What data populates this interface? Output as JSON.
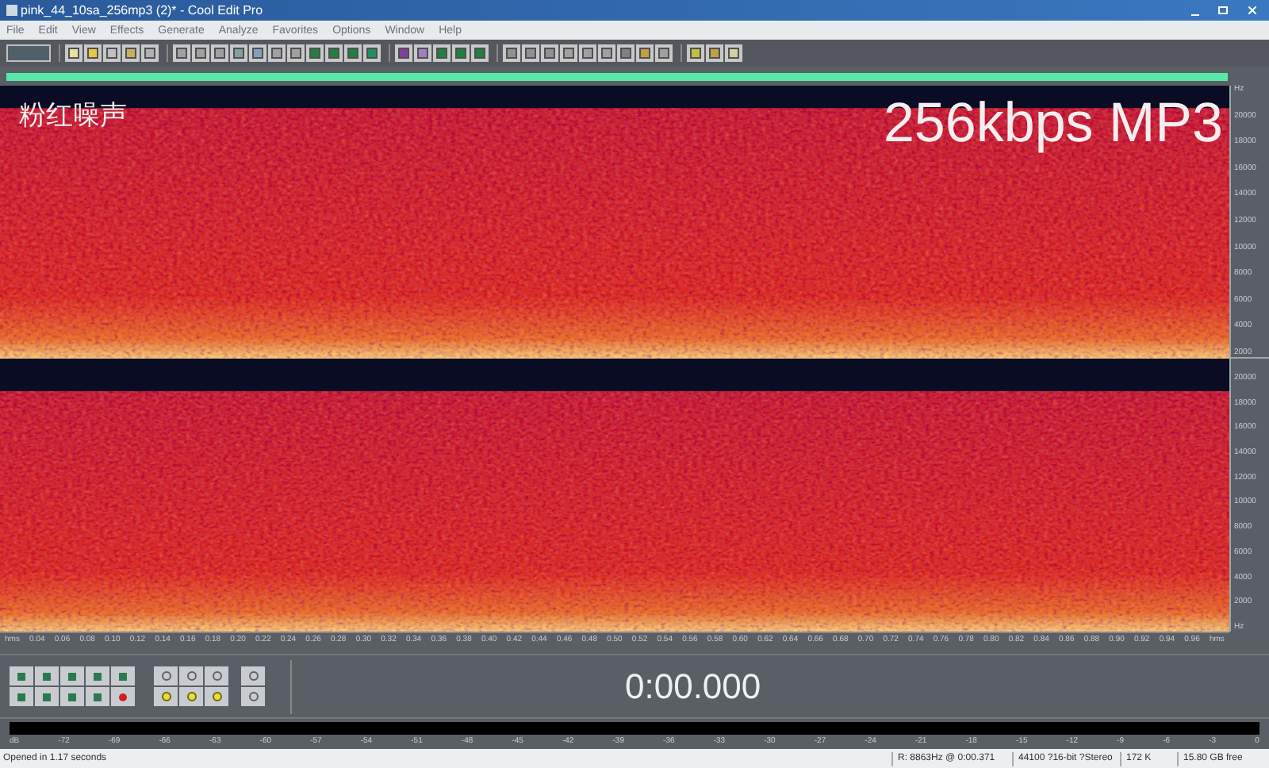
{
  "window": {
    "title": "pink_44_10sa_256mp3 (2)* - Cool Edit Pro"
  },
  "menu": [
    "File",
    "Edit",
    "View",
    "Effects",
    "Generate",
    "Analyze",
    "Favorites",
    "Options",
    "Window",
    "Help"
  ],
  "overlay": {
    "caption": "粉红噪声",
    "format": "256kbps MP3"
  },
  "channels": [
    {
      "freq_labels": [
        "Hz",
        "20000",
        "18000",
        "16000",
        "14000",
        "12000",
        "10000",
        "8000",
        "6000",
        "4000",
        "2000"
      ]
    },
    {
      "freq_labels": [
        "20000",
        "18000",
        "16000",
        "14000",
        "12000",
        "10000",
        "8000",
        "6000",
        "4000",
        "2000",
        "Hz"
      ]
    }
  ],
  "time_ruler": [
    "hms",
    "0.04",
    "0.06",
    "0.08",
    "0.10",
    "0.12",
    "0.14",
    "0.16",
    "0.18",
    "0.20",
    "0.22",
    "0.24",
    "0.26",
    "0.28",
    "0.30",
    "0.32",
    "0.34",
    "0.36",
    "0.38",
    "0.40",
    "0.42",
    "0.44",
    "0.46",
    "0.48",
    "0.50",
    "0.52",
    "0.54",
    "0.56",
    "0.58",
    "0.60",
    "0.62",
    "0.64",
    "0.66",
    "0.68",
    "0.70",
    "0.72",
    "0.74",
    "0.76",
    "0.78",
    "0.80",
    "0.82",
    "0.84",
    "0.86",
    "0.88",
    "0.90",
    "0.92",
    "0.94",
    "0.96",
    "hms"
  ],
  "time_display": "0:00.000",
  "level_meter": [
    "dB",
    "-72",
    "-69",
    "-66",
    "-63",
    "-60",
    "-57",
    "-54",
    "-51",
    "-48",
    "-45",
    "-42",
    "-39",
    "-36",
    "-33",
    "-30",
    "-27",
    "-24",
    "-21",
    "-18",
    "-15",
    "-12",
    "-9",
    "-6",
    "-3",
    "0"
  ],
  "status_bar": {
    "message": "Opened in 1.17 seconds",
    "cursor": "R: 8863Hz @  0:00.371",
    "format": "44100 ?16-bit ?Stereo",
    "size": "172 K",
    "free": "15.80 GB free"
  }
}
